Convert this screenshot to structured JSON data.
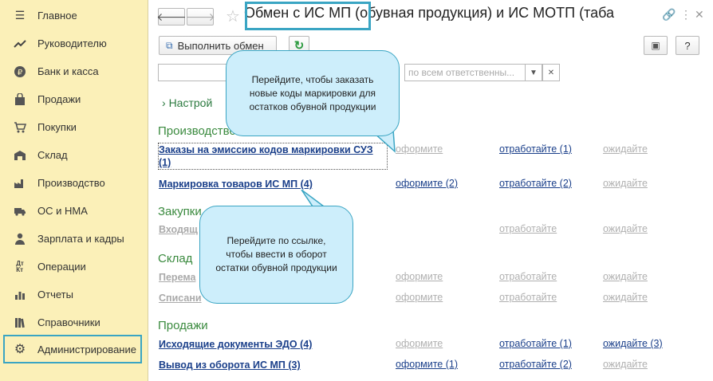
{
  "sidebar": {
    "items": [
      {
        "label": "Главное",
        "icon": "menu-icon"
      },
      {
        "label": "Руководителю",
        "icon": "trend-icon"
      },
      {
        "label": "Банк и касса",
        "icon": "coin-icon"
      },
      {
        "label": "Продажи",
        "icon": "bag-icon"
      },
      {
        "label": "Покупки",
        "icon": "cart-icon"
      },
      {
        "label": "Склад",
        "icon": "warehouse-icon"
      },
      {
        "label": "Производство",
        "icon": "factory-icon"
      },
      {
        "label": "ОС и НМА",
        "icon": "truck-icon"
      },
      {
        "label": "Зарплата и кадры",
        "icon": "person-icon"
      },
      {
        "label": "Операции",
        "icon": "dt-kt-icon"
      },
      {
        "label": "Отчеты",
        "icon": "bar-chart-icon"
      },
      {
        "label": "Справочники",
        "icon": "books-icon"
      },
      {
        "label": "Администрирование",
        "icon": "gear-icon"
      }
    ]
  },
  "header": {
    "title": "Обмен с ИС МП (обувная продукция) и ИС МОТП (таба"
  },
  "toolbar": {
    "exchange_label": "Выполнить обмен",
    "help_label": "?"
  },
  "filter": {
    "responsible_placeholder": "по всем ответственны..."
  },
  "settings_link": "Настрой",
  "sections": {
    "production": "Производство",
    "purchases": "Закупки",
    "warehouse": "Склад",
    "sales": "Продажи"
  },
  "rows": {
    "orders": {
      "label": "Заказы на эмиссию кодов маркировки СУЗ (1)",
      "s1": "оформите",
      "s2": "отработайте (1)",
      "s3": "ожидайте"
    },
    "marking": {
      "label": "Маркировка товаров ИС МП (4)",
      "s1": "оформите (2)",
      "s2": "отработайте (2)",
      "s3": "ожидайте"
    },
    "incoming": {
      "label": "Входящ",
      "s2": "отработайте",
      "s3": "ожидайте"
    },
    "transfer": {
      "label": "Перема",
      "s1": "оформите",
      "s2": "отработайте",
      "s3": "ожидайте"
    },
    "writeoff": {
      "label": "Списани",
      "s1": "оформите",
      "s2": "отработайте",
      "s3": "ожидайте"
    },
    "edo": {
      "label": "Исходящие документы ЭДО (4)",
      "s1": "оформите",
      "s2": "отработайте (1)",
      "s3": "ожидайте (3)"
    },
    "withdraw": {
      "label": "Вывод из оборота ИС МП (3)",
      "s1": "оформите (1)",
      "s2": "отработайте (2)",
      "s3": "ожидайте"
    }
  },
  "callouts": {
    "top": "Перейдите, чтобы заказать новые коды маркировки для остатков обувной продукции",
    "bottom": "Перейдите по ссылке, чтобы ввести в оборот остатки обувной продукции"
  },
  "colors": {
    "sidebar_bg": "#fbf0b8",
    "highlight": "#3aa5c3",
    "link": "#1a3f8a",
    "section": "#3a8a3e",
    "callout_bg": "#cdeefb"
  }
}
